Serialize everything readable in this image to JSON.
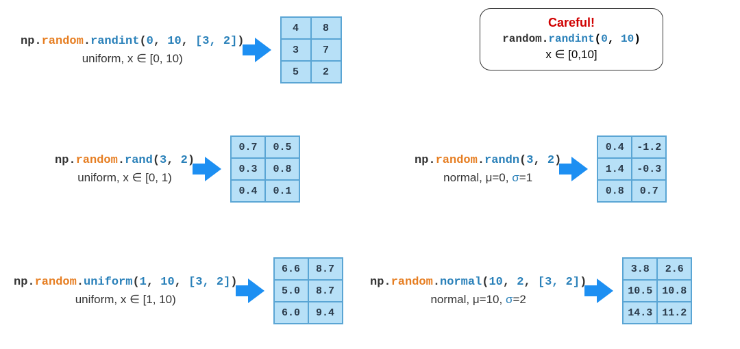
{
  "randint": {
    "prefix": "np.",
    "random": "random",
    "dot": ".",
    "fn": "randint",
    "args_html": "(0, 10, [3, 2])",
    "arg1": "0",
    "c1": ", ",
    "arg2": "10",
    "c2": ", ",
    "arg3": "[3, 2]",
    "desc_pre": "uniform, x ",
    "desc_rel": "∈",
    "desc_range": " [0, 10)",
    "cells": [
      "4",
      "8",
      "3",
      "7",
      "5",
      "2"
    ]
  },
  "careful": {
    "title": "Careful!",
    "random": "random",
    "dot": ".",
    "fn": "randint",
    "arg1": "0",
    "c1": ", ",
    "arg2": "10",
    "range_pre": "x ",
    "range_rel": "∈",
    "range_val": " [0,10]"
  },
  "rand": {
    "prefix": "np.",
    "random": "random",
    "dot": ".",
    "fn": "rand",
    "arg1": "3",
    "c1": ", ",
    "arg2": "2",
    "desc_pre": "uniform, x ",
    "desc_rel": "∈",
    "desc_range": " [0, 1)",
    "cells": [
      "0.7",
      "0.5",
      "0.3",
      "0.8",
      "0.4",
      "0.1"
    ]
  },
  "randn": {
    "prefix": "np.",
    "random": "random",
    "dot": ".",
    "fn": "randn",
    "arg1": "3",
    "c1": ", ",
    "arg2": "2",
    "desc_pre": "normal, μ=0,  ",
    "desc_sigma": "σ",
    "desc_sigval": "=1",
    "cells": [
      "0.4",
      "-1.2",
      "1.4",
      "-0.3",
      "0.8",
      "0.7"
    ]
  },
  "uniform": {
    "prefix": "np.",
    "random": "random",
    "dot": ".",
    "fn": "uniform",
    "arg1": "1",
    "c1": ", ",
    "arg2": "10",
    "c2": ", ",
    "arg3": "[3, 2]",
    "desc_pre": "uniform, x ",
    "desc_rel": "∈",
    "desc_range": " [1, 10)",
    "cells": [
      "6.6",
      "8.7",
      "5.0",
      "8.7",
      "6.0",
      "9.4"
    ]
  },
  "normal": {
    "prefix": "np.",
    "random": "random",
    "dot": ".",
    "fn": "normal",
    "arg1": "10",
    "c1": ", ",
    "arg2": "2",
    "c2": ", ",
    "arg3": "[3, 2]",
    "desc_pre": "normal, μ=10,  ",
    "desc_sigma": "σ",
    "desc_sigval": "=2",
    "cells": [
      "3.8",
      "2.6",
      "10.5",
      "10.8",
      "14.3",
      "11.2"
    ]
  }
}
